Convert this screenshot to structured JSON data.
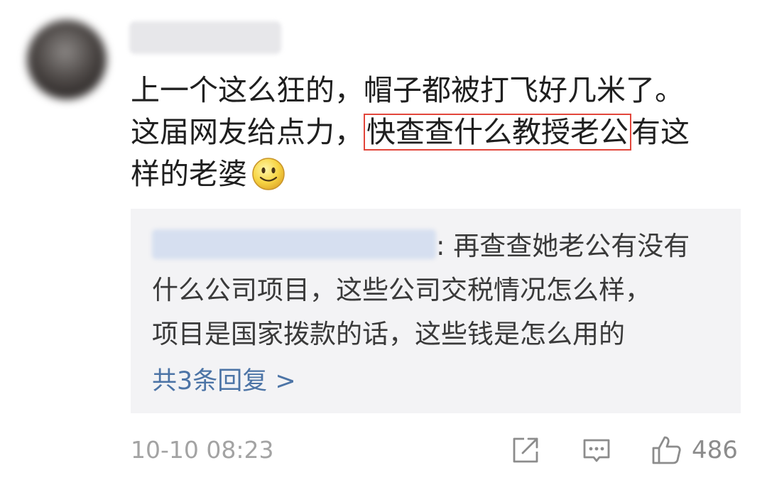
{
  "comment": {
    "author": "",
    "text_line1": "上一个这么狂的，帽子都被打飞好几米了。",
    "text_line2_before": "这届网友给点力，",
    "text_highlight": "快查查什么教授老公",
    "text_line2_after": "有这",
    "text_line3": "样的老婆",
    "emoji": "smile-emoji"
  },
  "reply": {
    "author": "",
    "text_first": ": 再查查她老公有没有",
    "text_second": "什么公司项目，这些公司交税情况怎么样，",
    "text_third": "项目是国家拨款的话，这些钱是怎么用的",
    "more_label": "共3条回复 >"
  },
  "footer": {
    "timestamp": "10-10 08:23",
    "like_count": "486",
    "icons": [
      "share-icon",
      "comment-icon",
      "thumbs-up-icon"
    ]
  },
  "colors": {
    "highlight_border": "#e2463b",
    "link": "#4c74a6",
    "muted": "#a3a3a3",
    "reply_bg": "#f3f3f5"
  }
}
